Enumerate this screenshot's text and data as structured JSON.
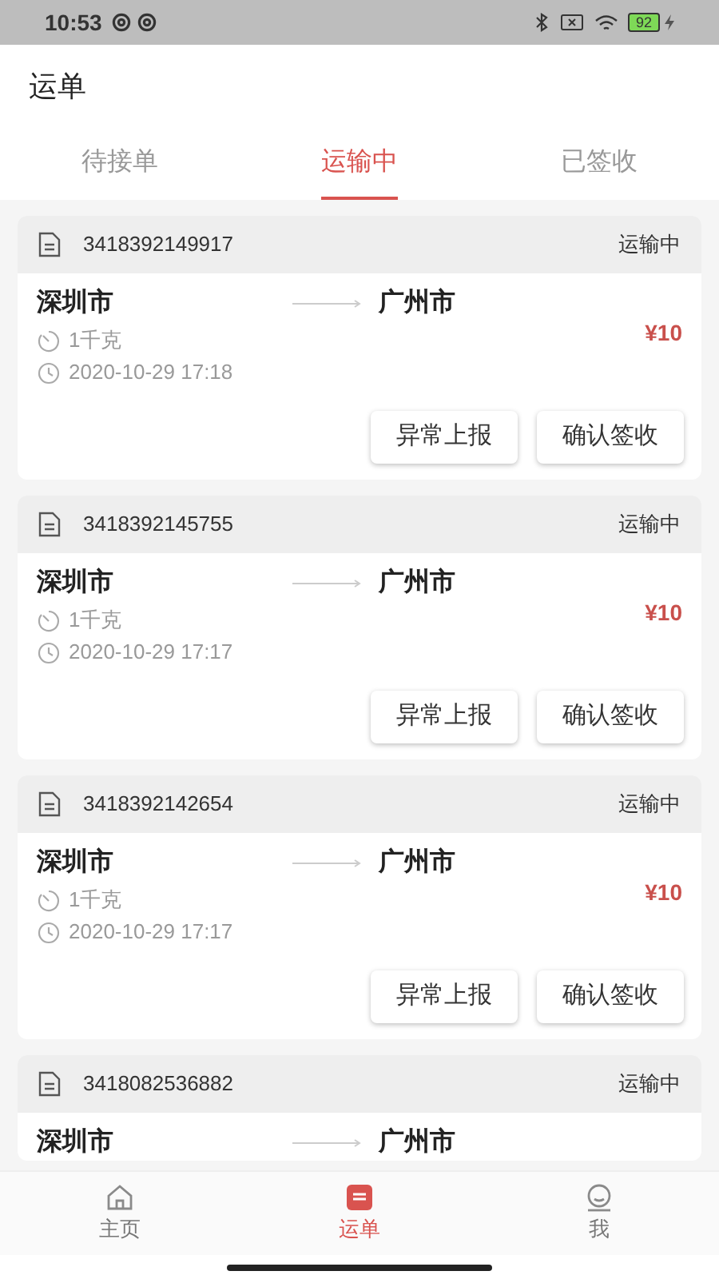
{
  "status_bar": {
    "time": "10:53",
    "battery": "92"
  },
  "header": {
    "title": "运单"
  },
  "tabs": [
    {
      "label": "待接单",
      "selected": false
    },
    {
      "label": "运输中",
      "selected": true
    },
    {
      "label": "已签收",
      "selected": false
    }
  ],
  "orders": [
    {
      "number": "3418392149917",
      "status": "运输中",
      "from": "深圳市",
      "to": "广州市",
      "weight": "1千克",
      "time": "2020-10-29 17:18",
      "price": "¥10",
      "buttons": [
        "异常上报",
        "确认签收"
      ]
    },
    {
      "number": "3418392145755",
      "status": "运输中",
      "from": "深圳市",
      "to": "广州市",
      "weight": "1千克",
      "time": "2020-10-29 17:17",
      "price": "¥10",
      "buttons": [
        "异常上报",
        "确认签收"
      ]
    },
    {
      "number": "3418392142654",
      "status": "运输中",
      "from": "深圳市",
      "to": "广州市",
      "weight": "1千克",
      "time": "2020-10-29 17:17",
      "price": "¥10",
      "buttons": [
        "异常上报",
        "确认签收"
      ]
    },
    {
      "number": "3418082536882",
      "status": "运输中",
      "from": "深圳市",
      "to": "广州市"
    }
  ],
  "bottom_nav": [
    {
      "label": "主页",
      "selected": false
    },
    {
      "label": "运单",
      "selected": true
    },
    {
      "label": "我",
      "selected": false
    }
  ]
}
